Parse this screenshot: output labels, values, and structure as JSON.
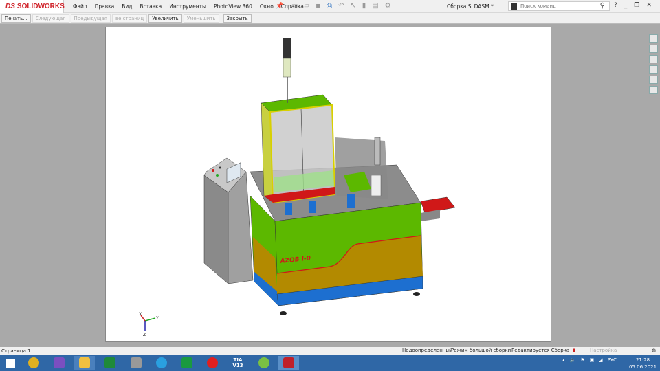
{
  "app": {
    "logo": "SOLIDWORKS",
    "logo_mark": "DS",
    "document_title": "Сборка.SLDASM *"
  },
  "menu": [
    "Файл",
    "Правка",
    "Вид",
    "Вставка",
    "Инструменты",
    "PhotoView 360",
    "Окно",
    "Справка"
  ],
  "search": {
    "placeholder": "Поиск команд"
  },
  "print_preview_toolbar": [
    {
      "label": "Печать...",
      "enabled": true
    },
    {
      "label": "Следующая",
      "enabled": false
    },
    {
      "label": "Предыдущая",
      "enabled": false
    },
    {
      "label": "ве страниц",
      "enabled": false
    },
    {
      "label": "Увеличить",
      "enabled": true
    },
    {
      "label": "Уменьшить",
      "enabled": false
    },
    {
      "label": "Закрыть",
      "enabled": true
    }
  ],
  "model": {
    "label": "AZOB I-0",
    "axes": {
      "x": "X",
      "y": "Y",
      "z": "Z"
    }
  },
  "status": {
    "page": "Страница 1",
    "definition": "Недоопределенный",
    "mode": "Режим большой сборки",
    "editing": "Редактируется Сборка",
    "settings": "Настройка"
  },
  "taskbar": {
    "apps": [
      "windows",
      "chrome",
      "visual-studio",
      "explorer",
      "calculator",
      "app",
      "edge",
      "store",
      "opera",
      "tia-v13",
      "utorrent",
      "solidworks-2017"
    ],
    "tia_label": "TIA V13",
    "lang": "РУС",
    "time": "21:28",
    "date": "05.06.2021"
  },
  "colors": {
    "machine_green": "#5cb800",
    "machine_ochre": "#b38a00",
    "machine_blue": "#1d6fd0",
    "accent_red": "#d01818",
    "taskbar": "#2f67a6"
  }
}
